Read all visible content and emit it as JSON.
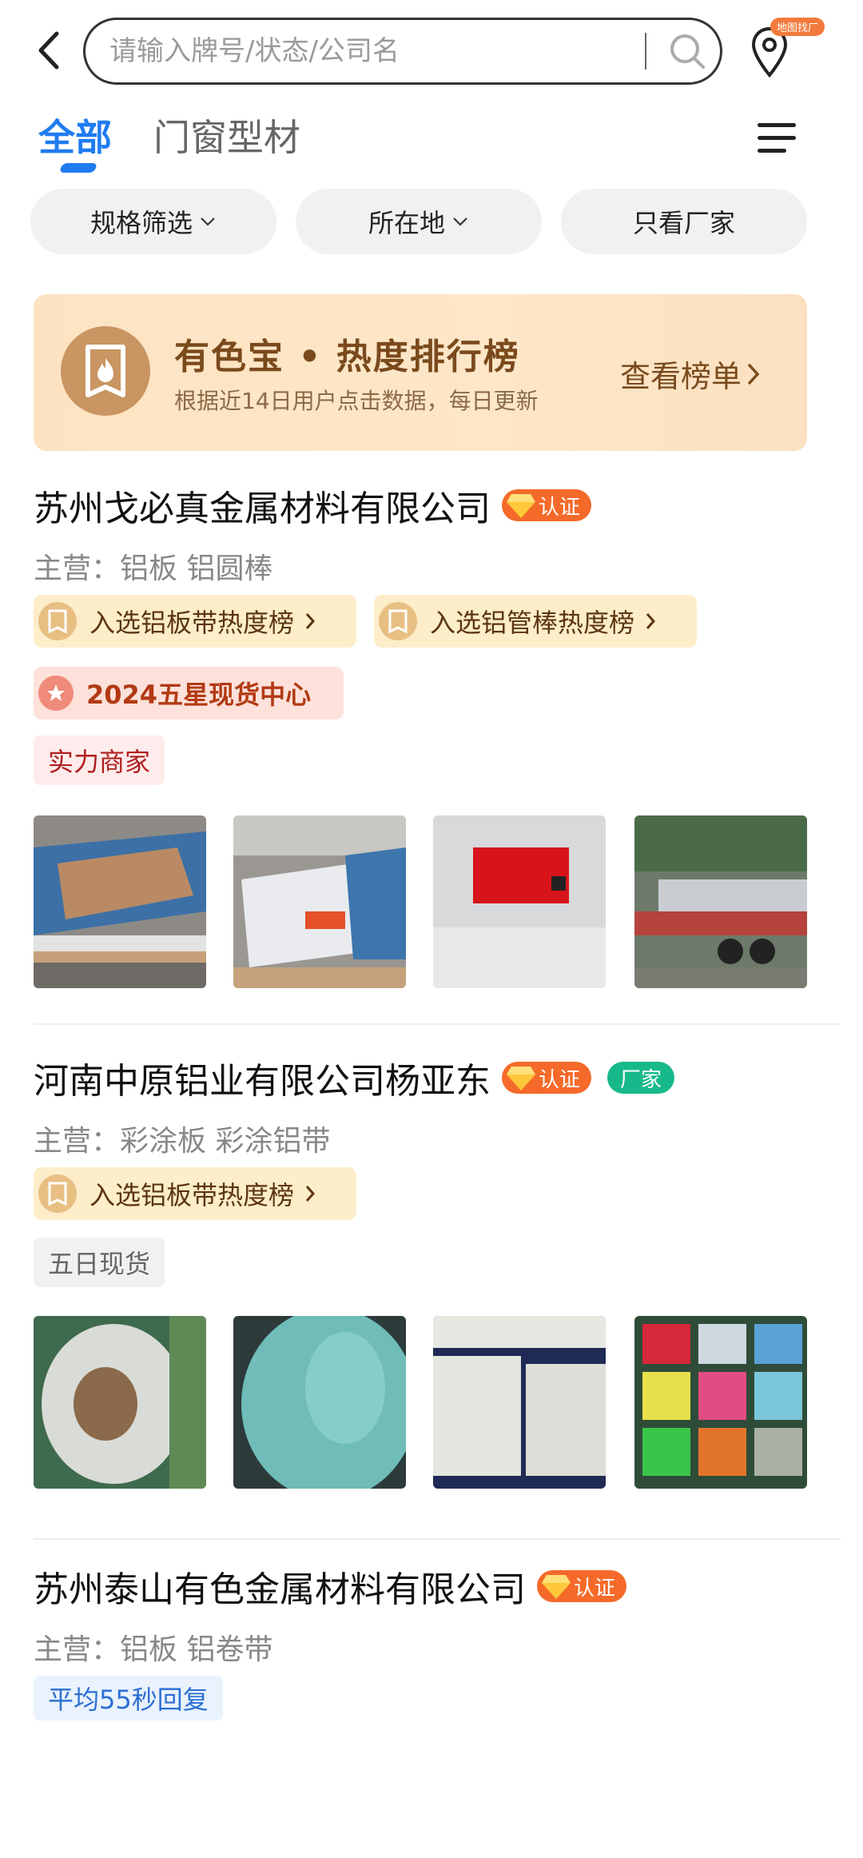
{
  "search": {
    "placeholder": "请输入牌号/状态/公司名",
    "map_badge": "地图找厂"
  },
  "tabs": [
    {
      "label": "全部",
      "active": true
    },
    {
      "label": "门窗型材",
      "active": false
    }
  ],
  "filters": [
    {
      "label": "规格筛选"
    },
    {
      "label": "所在地"
    },
    {
      "label": "只看厂家"
    }
  ],
  "banner": {
    "title": "有色宝 • 热度排行榜",
    "subtitle": "根据近14日用户点击数据，每日更新",
    "link_label": "查看榜单"
  },
  "listings": [
    {
      "company": "苏州戈必真金属材料有限公司",
      "cert_label": "认证",
      "main_business": "主营：铝板  铝圆棒",
      "hot_tags": [
        "入选铝板带热度榜",
        "入选铝管棒热度榜"
      ],
      "star_tag": "2024五星现货中心",
      "extra_tag": "实力商家"
    },
    {
      "company": "河南中原铝业有限公司杨亚东",
      "cert_label": "认证",
      "factory_label": "厂家",
      "main_business": "主营：彩涂板  彩涂铝带",
      "hot_tags": [
        "入选铝板带热度榜"
      ],
      "extra_tag": "五日现货"
    },
    {
      "company": "苏州泰山有色金属材料有限公司",
      "cert_label": "认证",
      "main_business": "主营：铝板  铝卷带",
      "extra_tag": "平均55秒回复"
    }
  ],
  "colors": {
    "accent": "#1f7cf0",
    "cert": "#f56a2a",
    "factory": "#17b98a",
    "banner_text": "#7a4a1d"
  }
}
